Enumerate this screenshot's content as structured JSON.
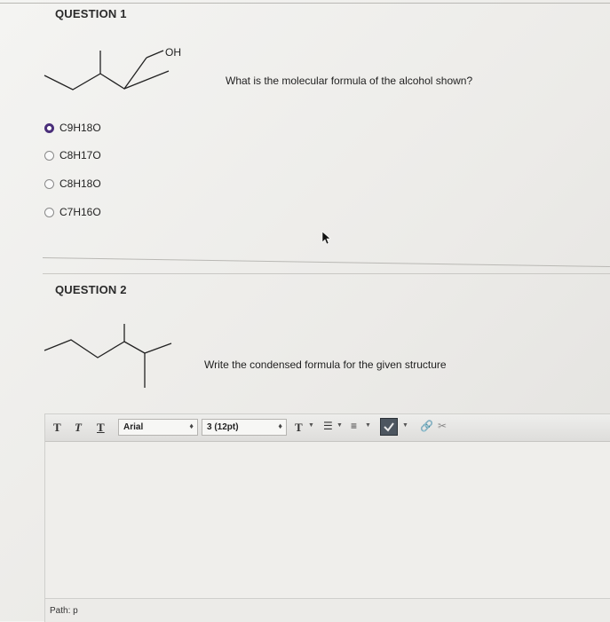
{
  "question1": {
    "title": "QUESTION 1",
    "prompt": "What is the molecular formula of the alcohol shown?",
    "structure_label": "OH",
    "options": [
      {
        "label": "C9H18O",
        "selected": true
      },
      {
        "label": "C8H17O",
        "selected": false
      },
      {
        "label": "C8H18O",
        "selected": false
      },
      {
        "label": "C7H16O",
        "selected": false
      }
    ]
  },
  "question2": {
    "title": "QUESTION 2",
    "prompt": "Write the condensed formula for the given structure"
  },
  "editor": {
    "toolbar": {
      "bold_label": "T",
      "italic_label": "T",
      "underline_label": "T",
      "font_family": "Arial",
      "font_size": "3 (12pt)",
      "text_color_label": "T"
    },
    "path_label": "Path: p"
  },
  "colors": {
    "selected_radio": "#4a2f7a"
  }
}
